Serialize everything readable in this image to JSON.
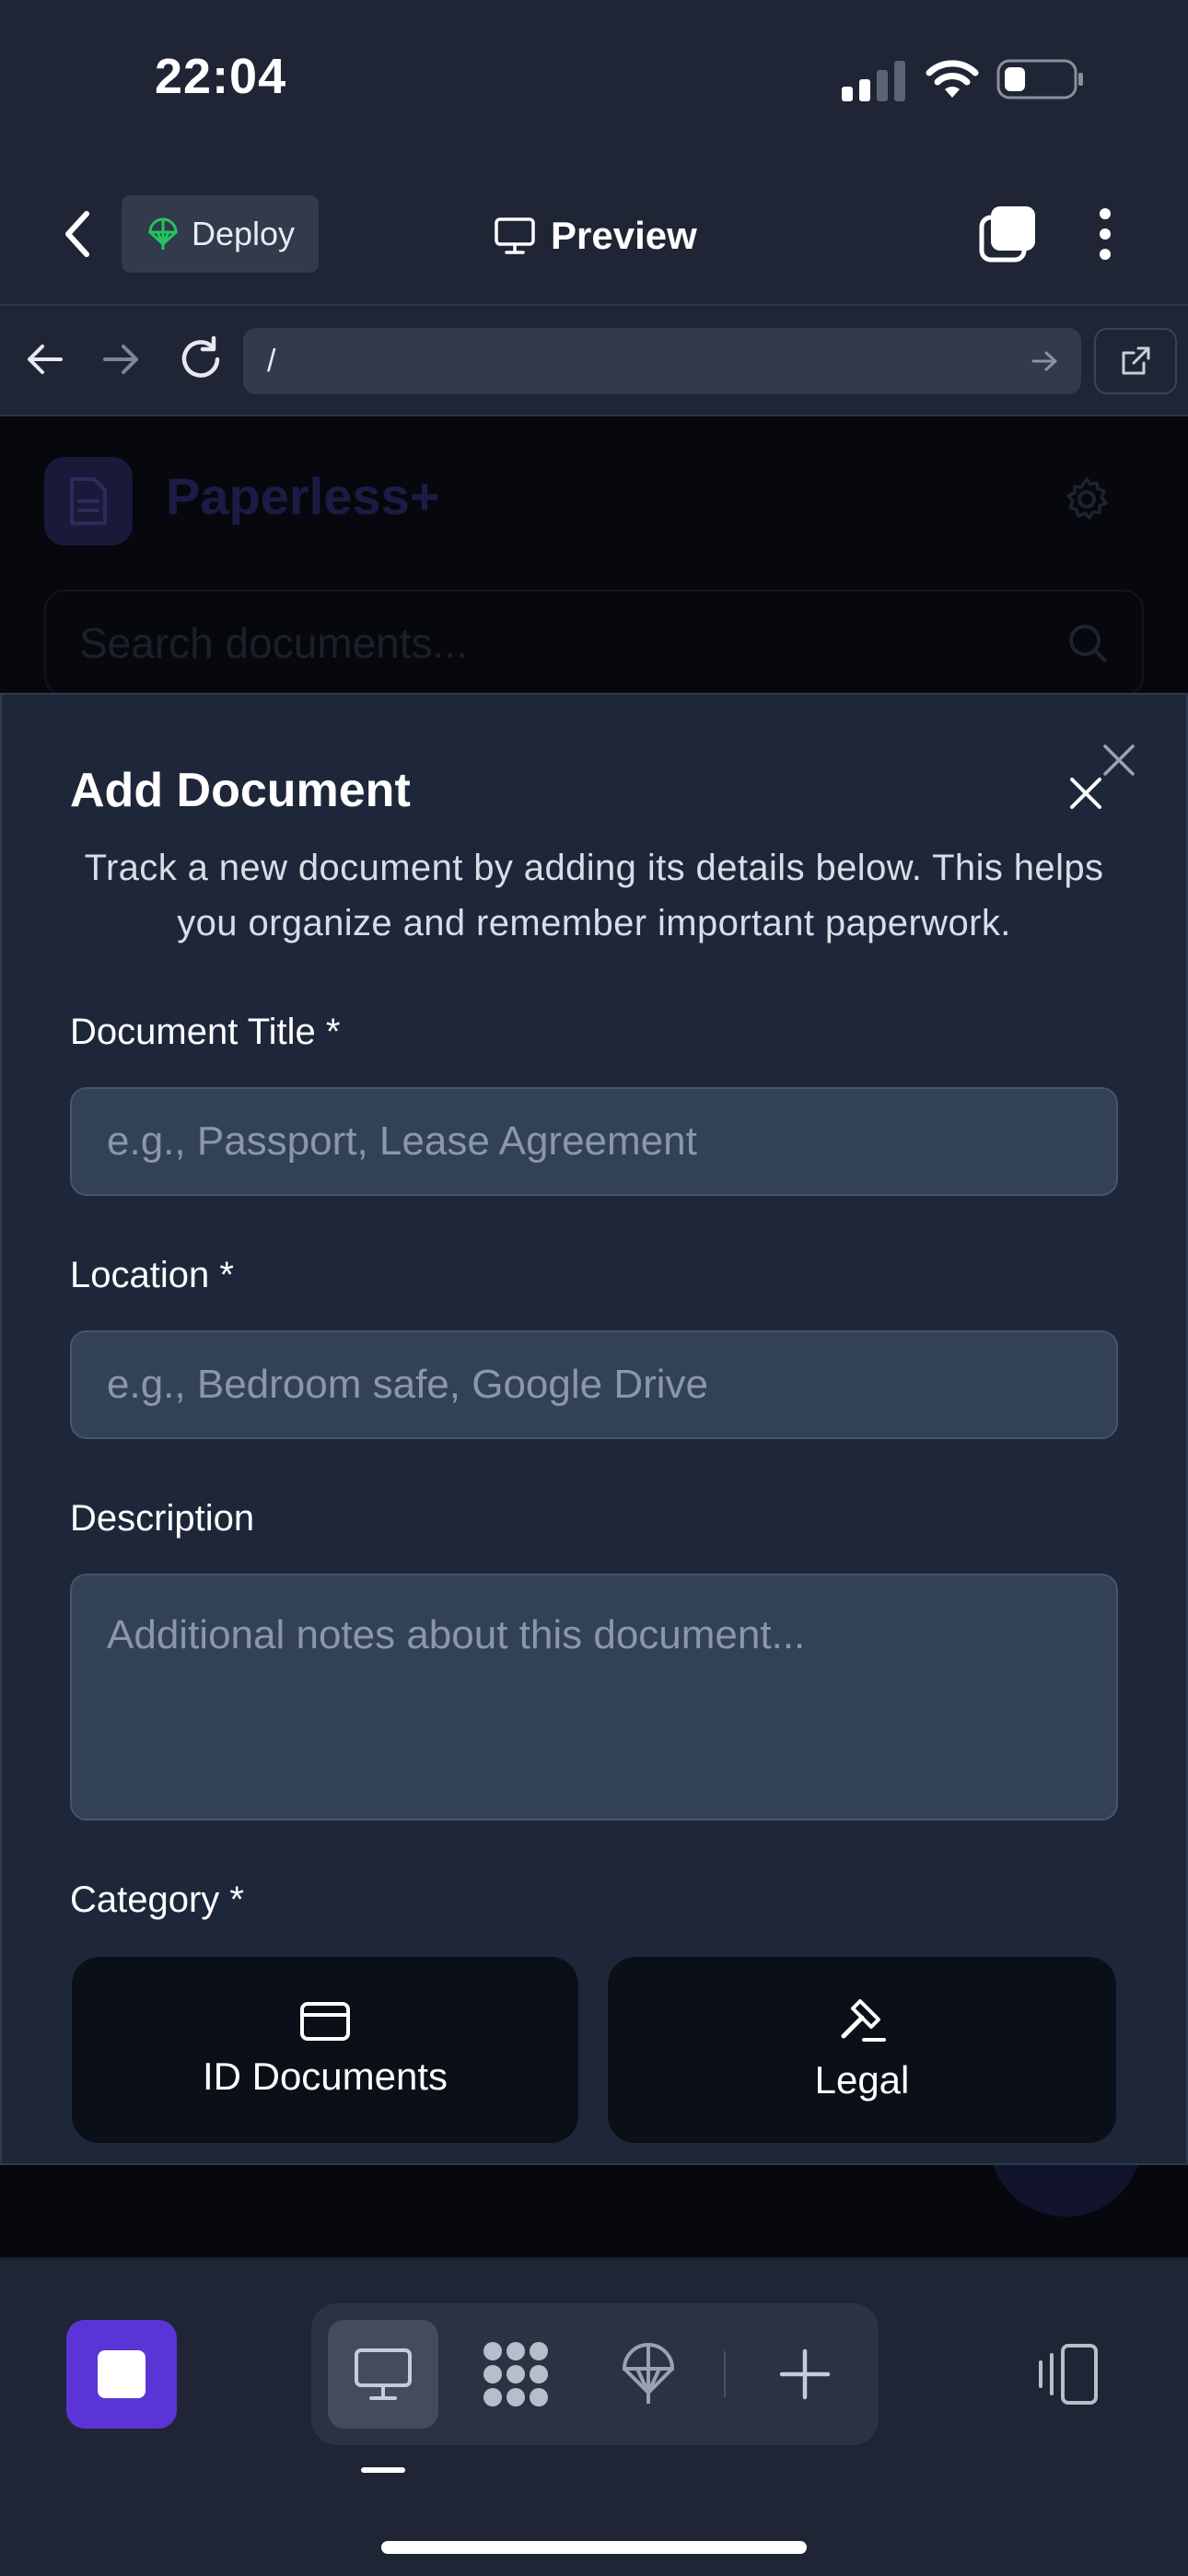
{
  "status_bar": {
    "time": "22:04"
  },
  "header": {
    "deploy_label": "Deploy",
    "preview_label": "Preview"
  },
  "browser": {
    "url": "/"
  },
  "background_page": {
    "brand": "Paperless+",
    "search_placeholder": "Search documents..."
  },
  "modal": {
    "title": "Add Document",
    "description": "Track a new document by adding its details below. This helps you organize and remember important paperwork.",
    "fields": {
      "title_label": "Document Title *",
      "title_placeholder": "e.g., Passport, Lease Agreement",
      "location_label": "Location *",
      "location_placeholder": "e.g., Bedroom safe, Google Drive",
      "description_label": "Description",
      "description_placeholder": "Additional notes about this document...",
      "category_label": "Category *"
    },
    "categories": [
      {
        "label": "ID Documents",
        "icon": "id-card-icon"
      },
      {
        "label": "Legal",
        "icon": "gavel-icon"
      }
    ]
  },
  "toolbar": {
    "modes": [
      "desktop-icon",
      "apps-grid-icon",
      "deploy-icon",
      "plus-icon"
    ],
    "active_mode": "desktop-icon"
  },
  "colors": {
    "background": "#1f2535",
    "modal": "#1e273a",
    "input": "#334155",
    "accent": "#5b34d6",
    "category_button": "#0b0f17"
  }
}
